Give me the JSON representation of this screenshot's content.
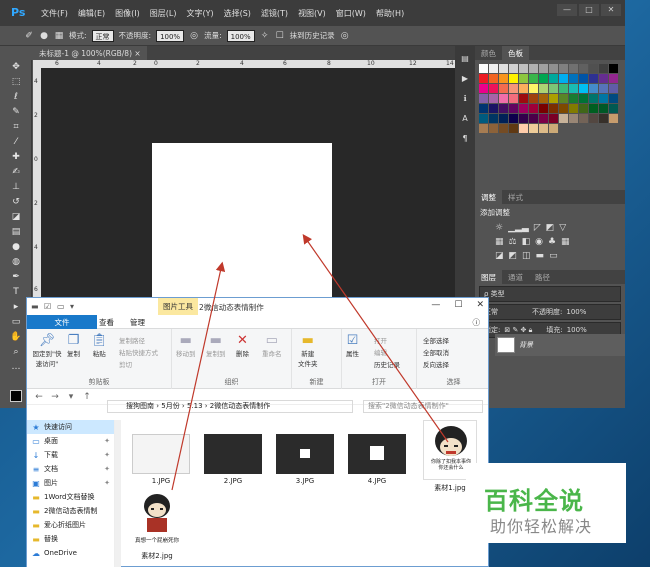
{
  "photoshop": {
    "logo": "Ps",
    "menu": [
      "文件(F)",
      "编辑(E)",
      "图像(I)",
      "图层(L)",
      "文字(Y)",
      "选择(S)",
      "滤镜(T)",
      "视图(V)",
      "窗口(W)",
      "帮助(H)"
    ],
    "window_buttons": [
      "—",
      "□",
      "✕"
    ],
    "options": {
      "mode_label": "模式:",
      "mode_value": "正常",
      "opacity_label": "不透明度:",
      "opacity_value": "100%",
      "flow_label": "流量:",
      "flow_value": "100%",
      "history_label": "抹到历史记录"
    },
    "doc_tab": "未标题-1 @ 100%(RGB/8) ×",
    "ruler_h_ticks": [
      "6",
      "4",
      "2",
      "0",
      "2",
      "4",
      "6",
      "8",
      "10",
      "12",
      "14"
    ],
    "ruler_v_ticks": [
      "4",
      "2",
      "0",
      "2",
      "4",
      "6",
      "8"
    ],
    "swatch_tabs": [
      "颜色",
      "色板"
    ],
    "adjust_tabs": [
      "调整",
      "样式"
    ],
    "adjust_title": "添加调整",
    "layers_tabs": [
      "图层",
      "通道",
      "路径"
    ],
    "layers_kind": "ρ 类型",
    "layers_mode": "正常",
    "layers_opacity_label": "不透明度:",
    "layers_opacity": "100%",
    "layers_lock_label": "锁定:",
    "layers_fill_label": "填充:",
    "layers_fill": "100%",
    "layer_name": "背景",
    "swatch_colors": [
      "#ffffff",
      "#f0f0f0",
      "#e0e0e0",
      "#d0d0d0",
      "#c0c0c0",
      "#b0b0b0",
      "#a0a0a0",
      "#909090",
      "#808080",
      "#707070",
      "#606060",
      "#505050",
      "#404040",
      "#000000",
      "#ed1c24",
      "#f26522",
      "#f7941d",
      "#fff200",
      "#8dc63f",
      "#39b54a",
      "#00a651",
      "#00a99d",
      "#00aeef",
      "#0072bc",
      "#0054a6",
      "#2e3192",
      "#662d91",
      "#92278f",
      "#ec008c",
      "#ed145b",
      "#f26c4f",
      "#f69679",
      "#fbaf5d",
      "#fff568",
      "#acd373",
      "#7cc576",
      "#3cb878",
      "#1abbb4",
      "#00bff3",
      "#448ccb",
      "#5674b9",
      "#605ca8",
      "#8560a8",
      "#a864a8",
      "#f06eaa",
      "#f26d7d",
      "#9e0b0f",
      "#a0410d",
      "#a36209",
      "#aba000",
      "#598527",
      "#197b30",
      "#007236",
      "#00746b",
      "#0076a3",
      "#004a80",
      "#003471",
      "#1b1464",
      "#440e62",
      "#630460",
      "#9e005d",
      "#9e0039",
      "#790000",
      "#7b2e00",
      "#7d4900",
      "#827b00",
      "#406618",
      "#005e20",
      "#005826",
      "#005952",
      "#005b7f",
      "#003663",
      "#002157",
      "#0d004c",
      "#32004b",
      "#4b0049",
      "#7b0046",
      "#7a0026",
      "#c7b299",
      "#998675",
      "#736357",
      "#534741",
      "#37302a",
      "#c69c6d",
      "#a67c52",
      "#8c6239",
      "#754c24",
      "#603913",
      "#ffccaa",
      "#eecc99",
      "#ddbb88",
      "#ccaa77"
    ]
  },
  "explorer": {
    "context_tab": "图片工具",
    "window_title": "2微信动态表情制作",
    "window_buttons": [
      "—",
      "☐",
      "✕"
    ],
    "ribbon_tabs": [
      "文件",
      "主页",
      "共享",
      "查看",
      "管理"
    ],
    "ribbon": {
      "pin_label": "固定到\"快速访问\"",
      "copy": "复制",
      "paste": "粘贴",
      "copy_path": "复制路径",
      "paste_shortcut": "粘贴快捷方式",
      "cut": "剪切",
      "clipboard_group": "剪贴板",
      "move_to": "移动到",
      "copy_to": "复制到",
      "delete": "删除",
      "rename": "重命名",
      "organize_group": "组织",
      "new_folder": "新建\n文件夹",
      "new_group": "新建",
      "properties": "属性",
      "open": "打开",
      "edit": "编辑",
      "history": "历史记录",
      "open_group": "打开",
      "select_all": "全部选择",
      "select_none": "全部取消",
      "invert": "反向选择",
      "select_group": "选择"
    },
    "breadcrumb": "搜狗图南 › 5月份 › 5.13 › 2微信动态表情制作",
    "search_placeholder": "搜索\"2微信动态表情制作\"",
    "nav_items": [
      {
        "icon": "★",
        "label": "快速访问",
        "pin": ""
      },
      {
        "icon": "▭",
        "label": "桌面",
        "pin": "✦"
      },
      {
        "icon": "↓",
        "label": "下载",
        "pin": "✦"
      },
      {
        "icon": "≡",
        "label": "文档",
        "pin": "✦"
      },
      {
        "icon": "▣",
        "label": "图片",
        "pin": "✦"
      },
      {
        "icon": "▬",
        "label": "1Word文档替换",
        "pin": ""
      },
      {
        "icon": "▬",
        "label": "2微信动态表情制",
        "pin": ""
      },
      {
        "icon": "▬",
        "label": "爱心折纸图片",
        "pin": ""
      },
      {
        "icon": "▬",
        "label": "替换",
        "pin": ""
      },
      {
        "icon": "☁",
        "label": "OneDrive",
        "pin": ""
      }
    ],
    "files": [
      "1.JPG",
      "2.JPG",
      "3.JPG",
      "4.JPG",
      "素材1.jpg",
      "素材2.jpg"
    ],
    "meme1_text": "你除了扣我本事你\n你还会什么",
    "meme2_text": "真想一个屁崩死你"
  },
  "watermark": {
    "title": "百科全说",
    "subtitle": "助你轻松解决"
  }
}
